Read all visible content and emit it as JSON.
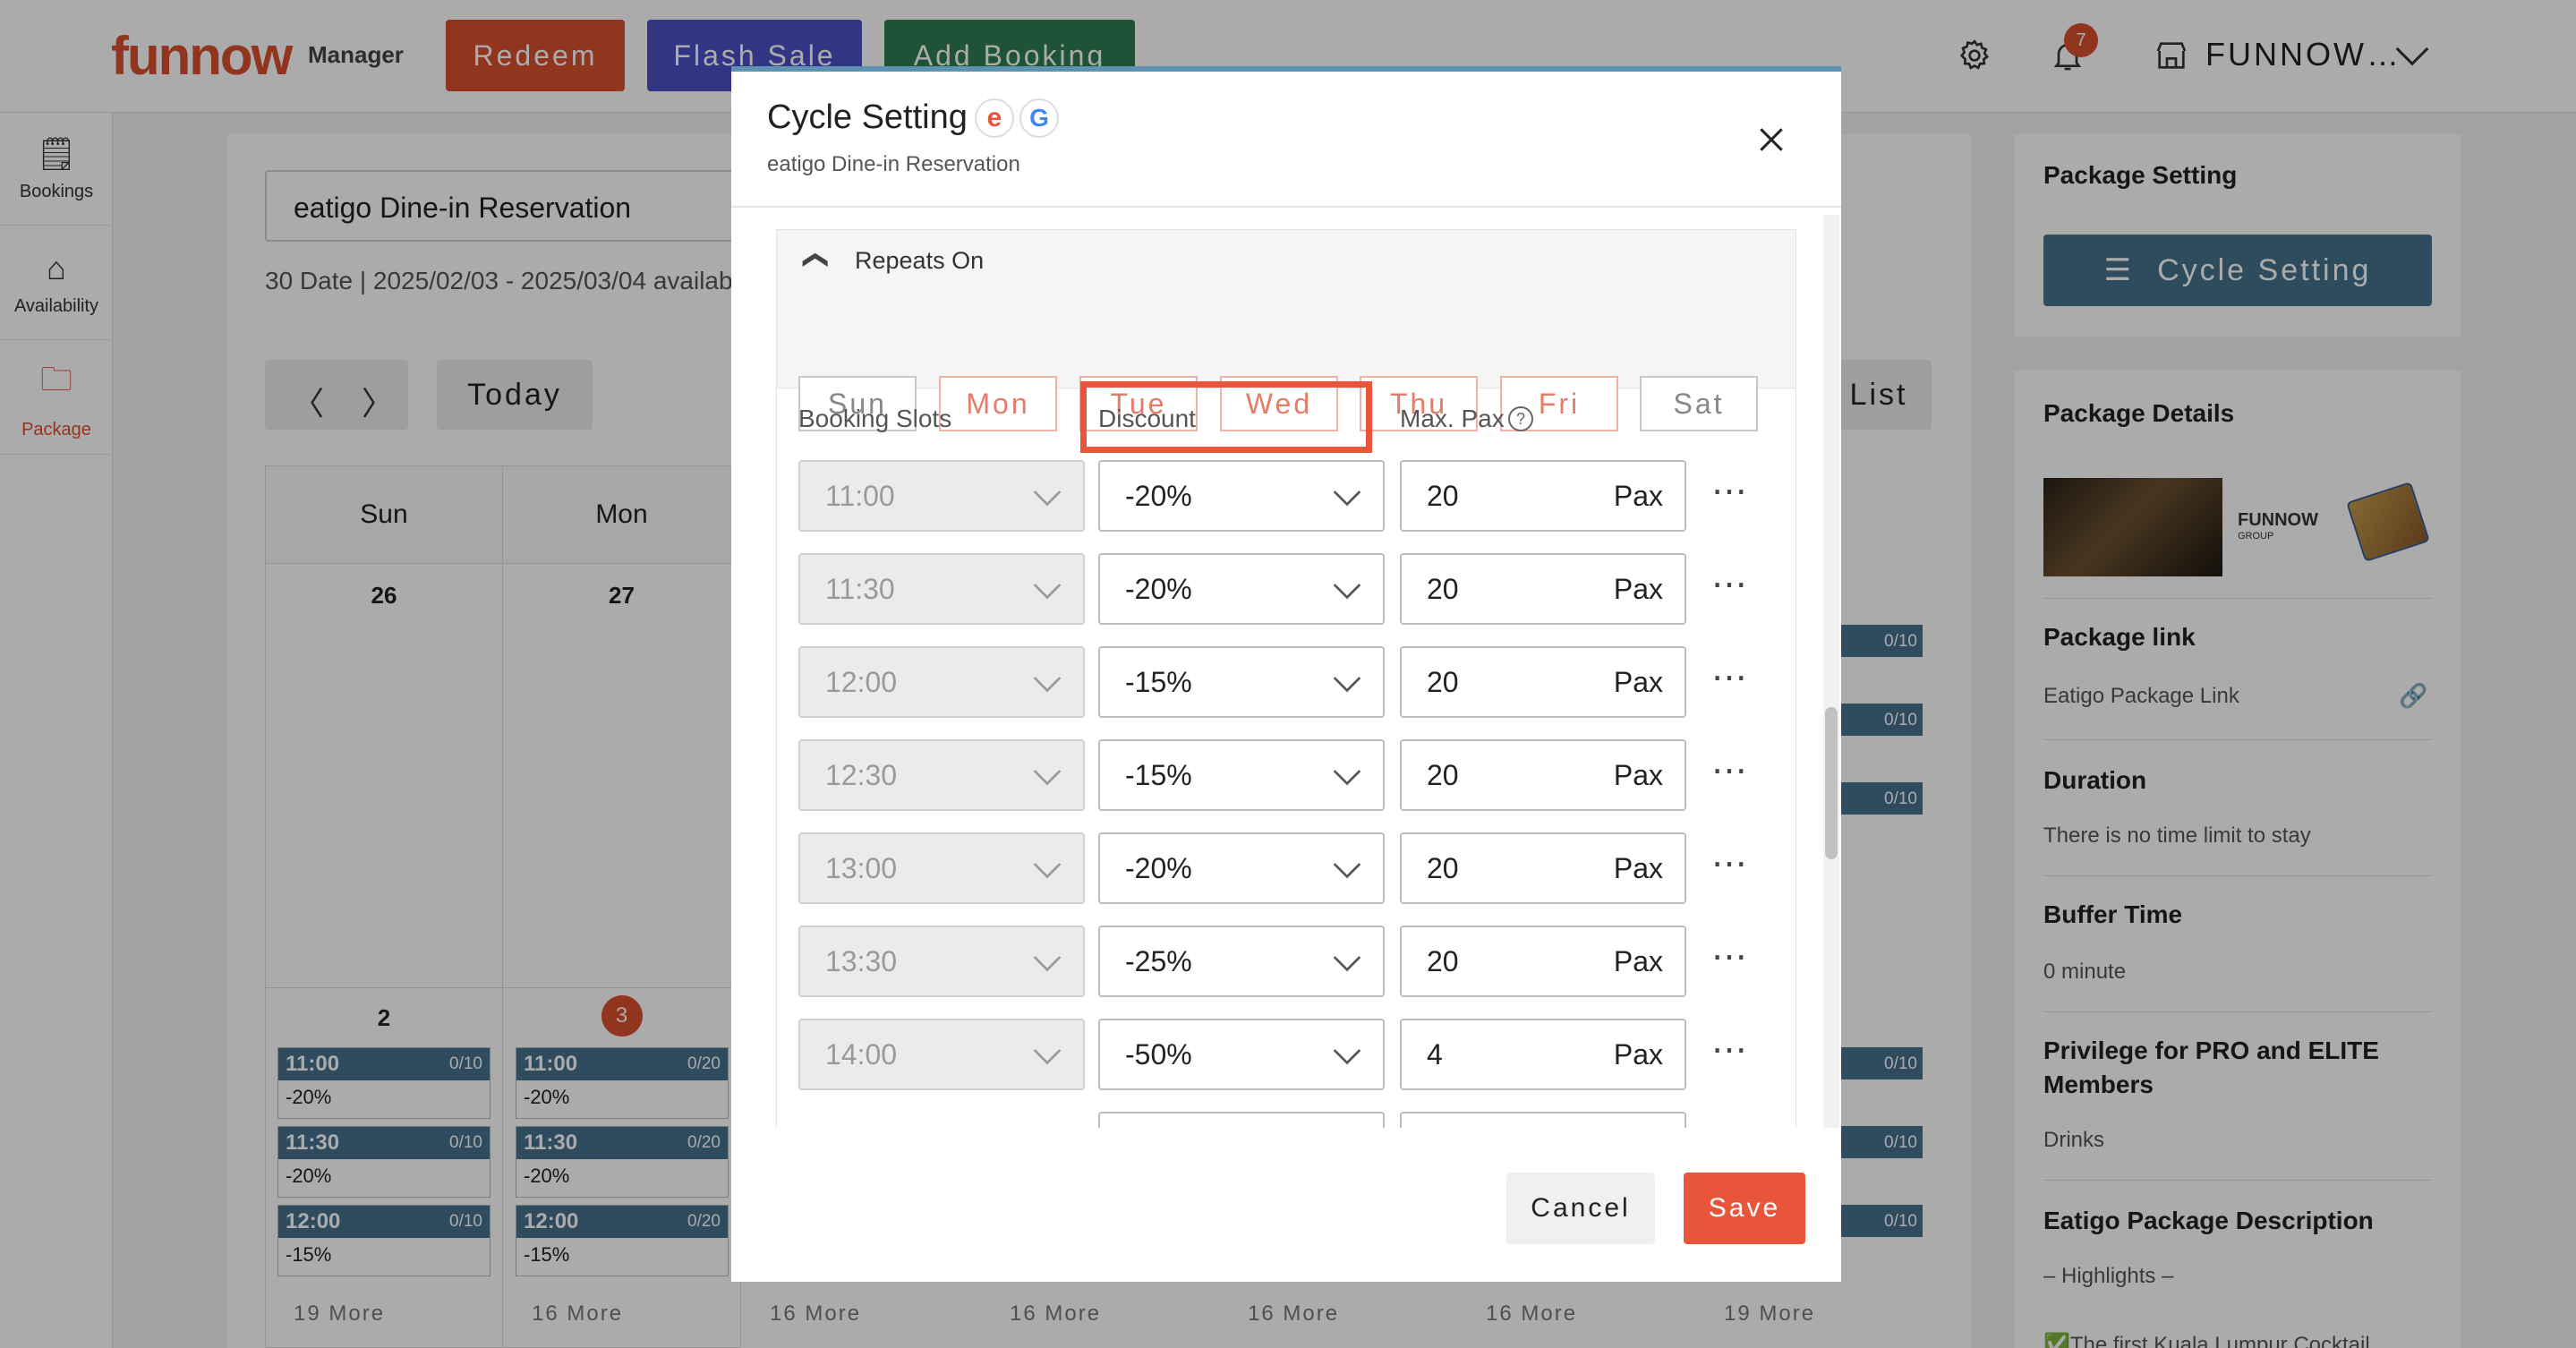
{
  "app": {
    "logo": "funnow",
    "logo_sub": "Manager",
    "store_name": "FUNNOW…",
    "notification_count": "7"
  },
  "top_buttons": [
    {
      "label": "Redeem",
      "color": "#d9502f"
    },
    {
      "label": "Flash Sale",
      "color": "#4b4fc4"
    },
    {
      "label": "Add Booking",
      "color": "#2e7d4f"
    }
  ],
  "sidebar": {
    "items": [
      {
        "label": "Bookings",
        "icon": "document-icon"
      },
      {
        "label": "Availability",
        "icon": "home-person-icon"
      },
      {
        "label": "Package",
        "icon": "folder-icon"
      }
    ]
  },
  "calendar": {
    "package_name": "eatigo Dine-in Reservation",
    "info": "30 Date | 2025/02/03 - 2025/03/04 availab",
    "today_label": "Today",
    "list_label": "List",
    "day_headers": [
      "Sun",
      "Mon"
    ],
    "week1_dates": [
      "26",
      "27"
    ],
    "week2_dates": [
      "2",
      "3"
    ],
    "col0_slots": [
      {
        "time": "11:00",
        "count": "0/10",
        "discount": "-20%"
      },
      {
        "time": "11:30",
        "count": "0/10",
        "discount": "-20%"
      },
      {
        "time": "12:00",
        "count": "0/10",
        "discount": "-15%"
      }
    ],
    "col1_slots": [
      {
        "time": "11:00",
        "count": "0/20",
        "discount": "-20%"
      },
      {
        "time": "11:30",
        "count": "0/20",
        "discount": "-20%"
      },
      {
        "time": "12:00",
        "count": "0/20",
        "discount": "-15%"
      }
    ],
    "right_counts": [
      "0/10",
      "0/10",
      "0/10"
    ],
    "right_bottom_counts": [
      "0/10",
      "0/10",
      "0/10"
    ],
    "more_labels": [
      "19 More",
      "16 More",
      "16 More",
      "16 More",
      "16 More",
      "16 More",
      "19 More"
    ]
  },
  "package_panel": {
    "setting_title": "Package Setting",
    "cycle_button": "Cycle Setting",
    "details_title": "Package Details",
    "brand_logo": "FUNNOW",
    "brand_logo_sub": "GROUP",
    "link_title": "Package link",
    "link_text": "Eatigo Package Link",
    "duration_title": "Duration",
    "duration_text": "There is no time limit to stay",
    "buffer_title": "Buffer Time",
    "buffer_text": "0 minute",
    "privilege_title_1": "Privilege for PRO and ELITE",
    "privilege_title_2": "Members",
    "privilege_text": "Drinks",
    "desc_title": "Eatigo Package Description",
    "desc_text": "– Highlights –",
    "desc_text2": "✅The first Kuala Lumpur Cocktail"
  },
  "modal": {
    "title": "Cycle Setting",
    "subtitle": "eatigo Dine-in Reservation",
    "eatigo_badge": "e",
    "google_badge": "G",
    "repeats_label": "Repeats On",
    "days": [
      {
        "label": "Sun",
        "active": false
      },
      {
        "label": "Mon",
        "active": true
      },
      {
        "label": "Tue",
        "active": true
      },
      {
        "label": "Wed",
        "active": true
      },
      {
        "label": "Thu",
        "active": true
      },
      {
        "label": "Fri",
        "active": true
      },
      {
        "label": "Sat",
        "active": false
      }
    ],
    "col_booking": "Booking Slots",
    "col_discount": "Discount",
    "col_maxpax": "Max. Pax",
    "pax_unit": "Pax",
    "rows": [
      {
        "time": "11:00",
        "discount": "-20%",
        "pax": "20"
      },
      {
        "time": "11:30",
        "discount": "-20%",
        "pax": "20"
      },
      {
        "time": "12:00",
        "discount": "-15%",
        "pax": "20"
      },
      {
        "time": "12:30",
        "discount": "-15%",
        "pax": "20"
      },
      {
        "time": "13:00",
        "discount": "-20%",
        "pax": "20"
      },
      {
        "time": "13:30",
        "discount": "-25%",
        "pax": "20"
      },
      {
        "time": "14:00",
        "discount": "-50%",
        "pax": "4"
      }
    ],
    "cancel_label": "Cancel",
    "save_label": "Save",
    "accent": "#e8553a",
    "highlight_color": "#e8553a"
  }
}
